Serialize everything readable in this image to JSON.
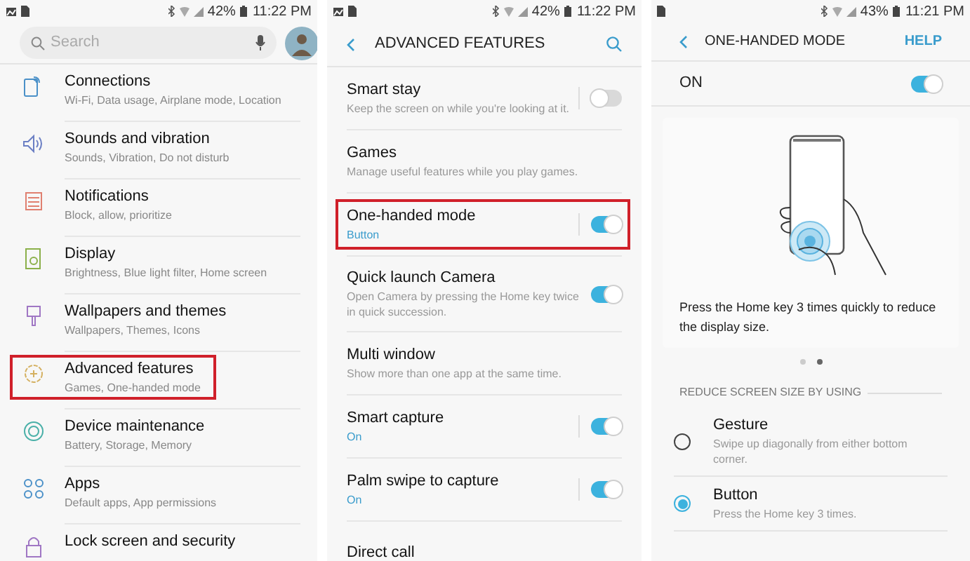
{
  "panels": [
    {
      "kind": "settings",
      "status_bar": {
        "battery": "42%",
        "time": "11:22 PM"
      },
      "search": {
        "placeholder": "Search"
      },
      "items": [
        {
          "title": "Connections",
          "subtitle": "Wi-Fi, Data usage, Airplane mode, Location",
          "highlighted": false
        },
        {
          "title": "Sounds and vibration",
          "subtitle": "Sounds, Vibration, Do not disturb",
          "highlighted": false
        },
        {
          "title": "Notifications",
          "subtitle": "Block, allow, prioritize",
          "highlighted": false
        },
        {
          "title": "Display",
          "subtitle": "Brightness, Blue light filter, Home screen",
          "highlighted": false
        },
        {
          "title": "Wallpapers and themes",
          "subtitle": "Wallpapers, Themes, Icons",
          "highlighted": false
        },
        {
          "title": "Advanced features",
          "subtitle": "Games, One-handed mode",
          "highlighted": true
        },
        {
          "title": "Device maintenance",
          "subtitle": "Battery, Storage, Memory",
          "highlighted": false
        },
        {
          "title": "Apps",
          "subtitle": "Default apps, App permissions",
          "highlighted": false
        },
        {
          "title": "Lock screen and security",
          "highlighted": false
        }
      ]
    },
    {
      "kind": "features",
      "status_bar": {
        "battery": "42%",
        "time": "11:22 PM"
      },
      "title": "ADVANCED FEATURES",
      "items": [
        {
          "kind": "split-switch",
          "title": "Smart stay",
          "subtitle": "Keep the screen on while you're looking at it.",
          "on": false,
          "highlighted": false
        },
        {
          "kind": "plain",
          "title": "Games",
          "subtitle": "Manage useful features while you play games.",
          "highlighted": false
        },
        {
          "kind": "split-switch",
          "title": "One-handed mode",
          "status": "Button",
          "on": true,
          "highlighted": true
        },
        {
          "kind": "switch",
          "title": "Quick launch Camera",
          "subtitle": "Open Camera by pressing the Home key twice in quick succession.",
          "on": true,
          "highlighted": false
        },
        {
          "kind": "plain",
          "title": "Multi window",
          "subtitle": "Show more than one app at the same time.",
          "highlighted": false
        },
        {
          "kind": "split-switch",
          "title": "Smart capture",
          "status": "On",
          "on": true,
          "highlighted": false
        },
        {
          "kind": "split-switch",
          "title": "Palm swipe to capture",
          "status": "On",
          "on": true,
          "highlighted": false
        },
        {
          "kind": "plain",
          "title": "Direct call",
          "highlighted": false
        }
      ]
    },
    {
      "kind": "detail",
      "status_bar": {
        "battery": "43%",
        "time": "11:21 PM"
      },
      "title": "ONE-HANDED MODE",
      "help": "HELP",
      "master": {
        "label": "ON",
        "on": true
      },
      "caption": "Press the Home key 3 times quickly to reduce the display size.",
      "pager": [
        {
          "selected": false
        },
        {
          "selected": true
        }
      ],
      "section": "REDUCE SCREEN SIZE BY USING",
      "options": [
        {
          "title": "Gesture",
          "subtitle": "Swipe up diagonally from either bottom corner.",
          "selected": false
        },
        {
          "title": "Button",
          "subtitle": "Press the Home key 3 times.",
          "selected": true
        }
      ]
    }
  ]
}
